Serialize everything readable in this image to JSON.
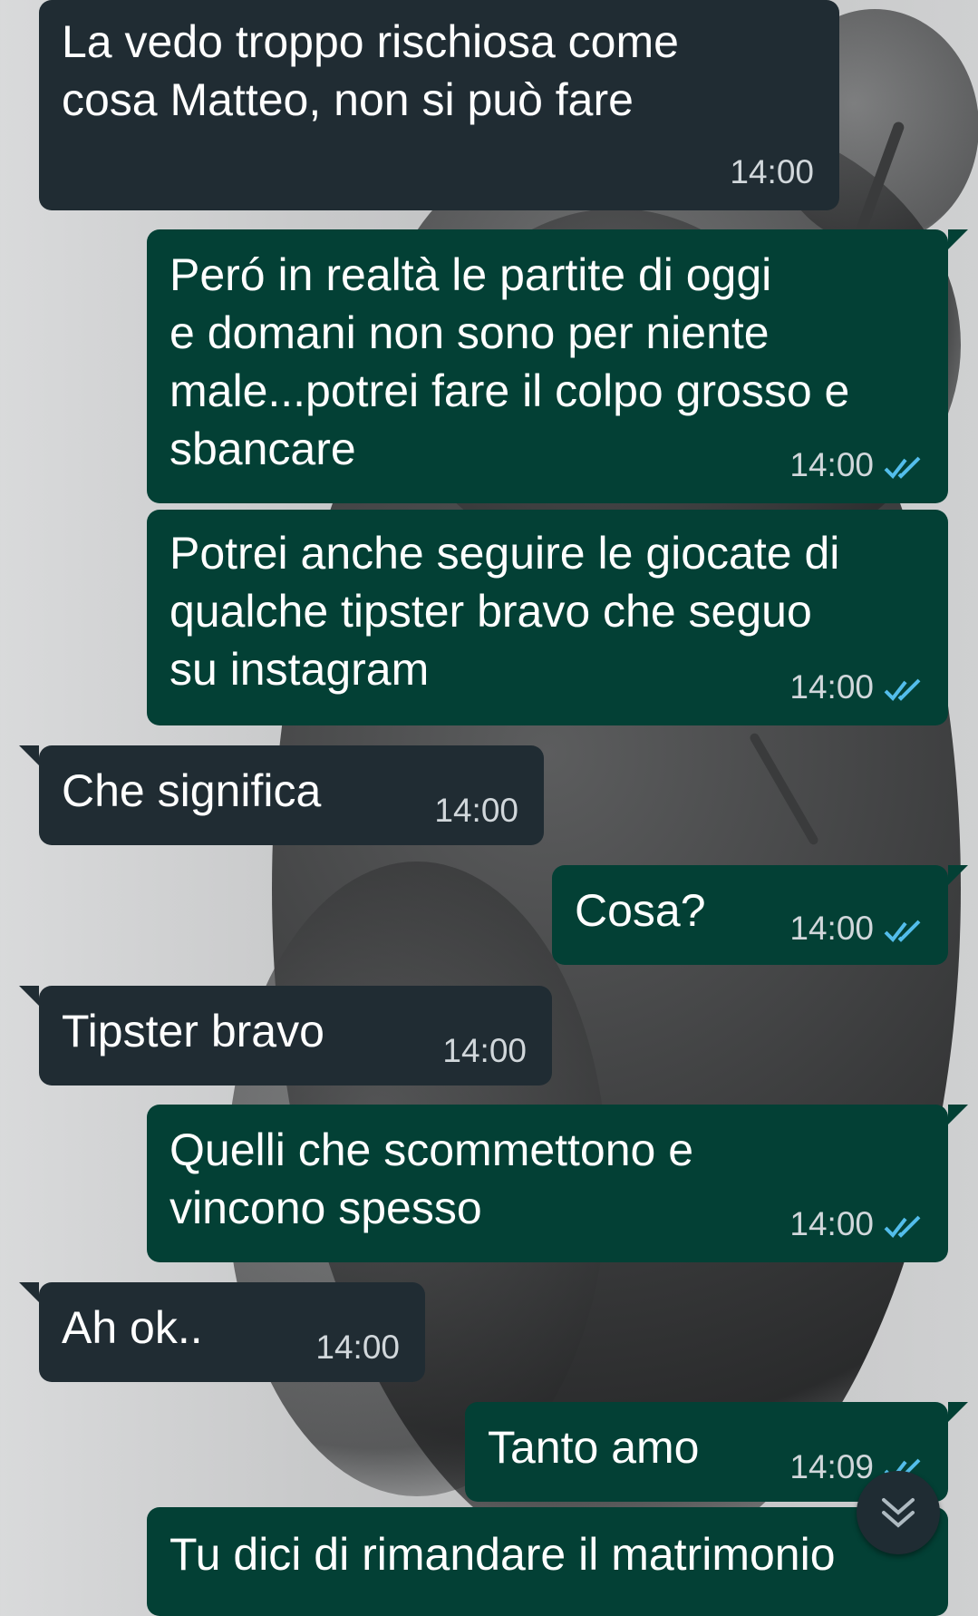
{
  "messages": [
    {
      "dir": "in",
      "text": "La vedo troppo rischiosa come\ncosa Matteo, non si può fare",
      "time": "14:00"
    },
    {
      "dir": "out",
      "text": "Peró in realtà le partite di oggi\ne domani non sono per niente\nmale...potrei fare il colpo grosso e\nsbancare",
      "time": "14:00",
      "status": "read"
    },
    {
      "dir": "out",
      "text": "Potrei anche seguire le giocate di\nqualche tipster bravo che seguo\nsu instagram",
      "time": "14:00",
      "status": "read"
    },
    {
      "dir": "in",
      "text": "Che significa",
      "time": "14:00"
    },
    {
      "dir": "out",
      "text": "Cosa?",
      "time": "14:00",
      "status": "read"
    },
    {
      "dir": "in",
      "text": "Tipster bravo",
      "time": "14:00"
    },
    {
      "dir": "out",
      "text": "Quelli che scommettono e\nvincono spesso",
      "time": "14:00",
      "status": "read"
    },
    {
      "dir": "in",
      "text": "Ah ok..",
      "time": "14:00"
    },
    {
      "dir": "out",
      "text": "Tanto amo",
      "time": "14:09",
      "status": "read"
    },
    {
      "dir": "out",
      "text": "Tu dici di rimandare il matrimonio",
      "time": "",
      "status": ""
    }
  ],
  "colors": {
    "incoming_bubble": "#202c33",
    "outgoing_bubble": "#034035",
    "read_ticks": "#53bdeb",
    "timestamp": "#d1d7db"
  },
  "icons": {
    "read_status": "double-check-icon",
    "scroll_down": "double-chevron-down-icon"
  }
}
